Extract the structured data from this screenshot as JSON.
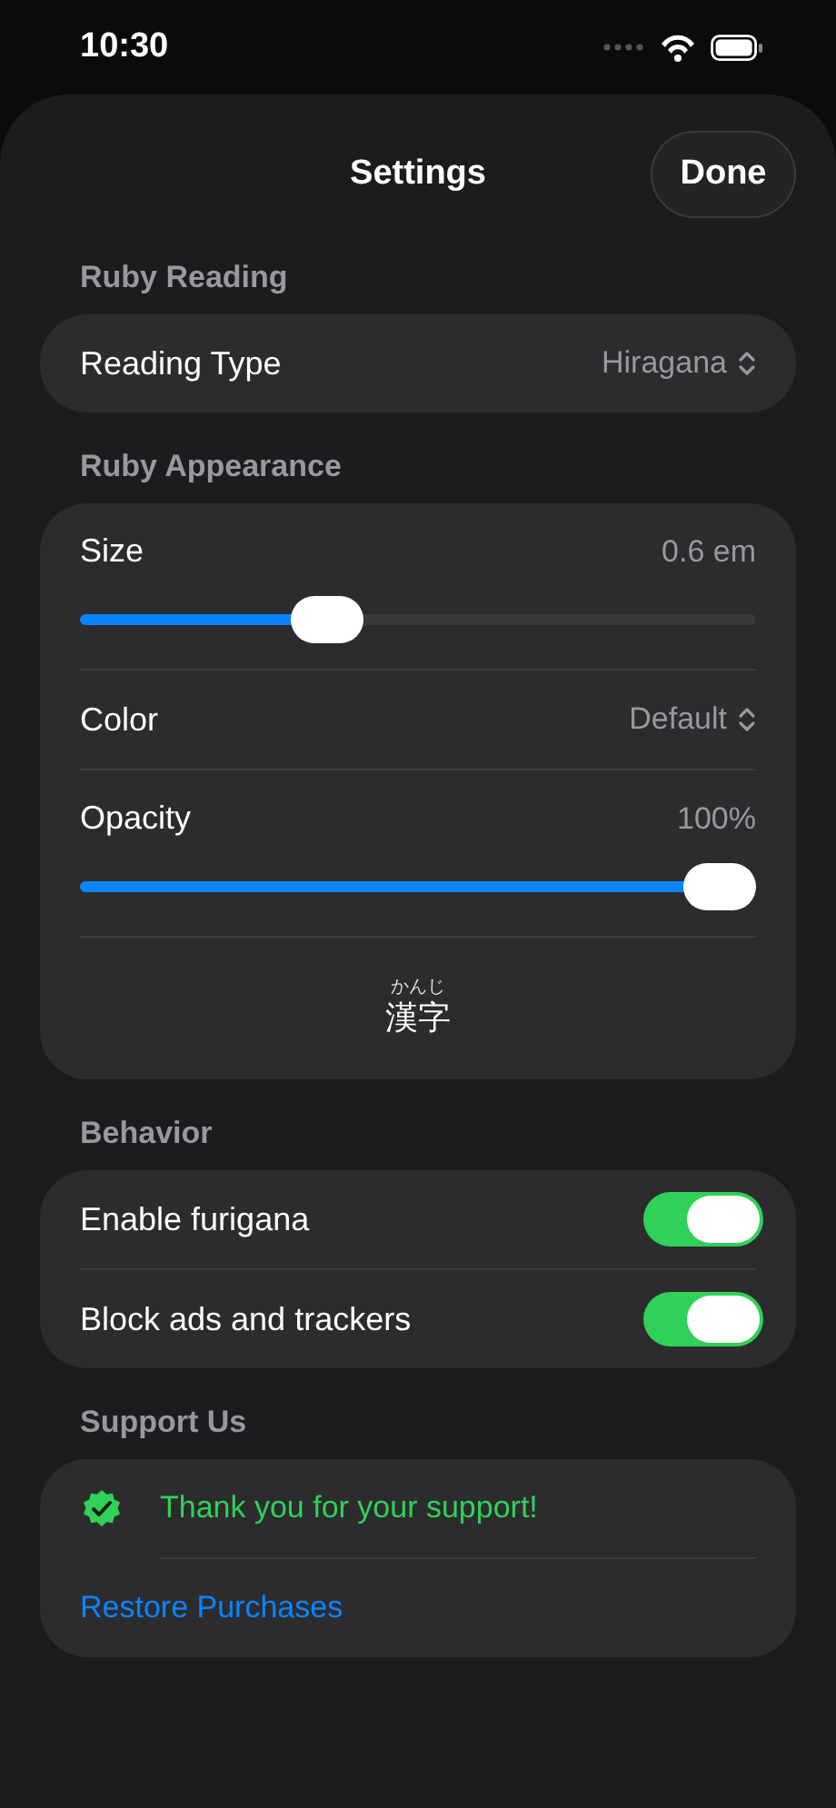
{
  "status_bar": {
    "time": "10:30"
  },
  "header": {
    "title": "Settings",
    "done_button": "Done"
  },
  "sections": [
    {
      "title": "Ruby Reading",
      "rows": [
        {
          "kind": "picker",
          "label": "Reading Type",
          "value": "Hiragana"
        }
      ]
    },
    {
      "title": "Ruby Appearance",
      "rows": [
        {
          "kind": "slider",
          "label": "Size",
          "value": "0.6 em",
          "level": 0.35
        },
        {
          "kind": "picker",
          "label": "Color",
          "value": "Default"
        },
        {
          "kind": "slider",
          "label": "Opacity",
          "value": "100%",
          "level": 1
        },
        {
          "kind": "preview",
          "reading": "かんじ",
          "base": "漢字"
        }
      ]
    },
    {
      "title": "Behavior",
      "rows": [
        {
          "kind": "toggle",
          "label": "Enable furigana",
          "on": true
        },
        {
          "kind": "toggle",
          "label": "Block ads and trackers",
          "on": true
        }
      ]
    },
    {
      "title": "Support Us",
      "rows": [
        {
          "kind": "status",
          "text": "Thank you for your support!"
        },
        {
          "kind": "link",
          "text": "Restore Purchases"
        }
      ]
    }
  ]
}
